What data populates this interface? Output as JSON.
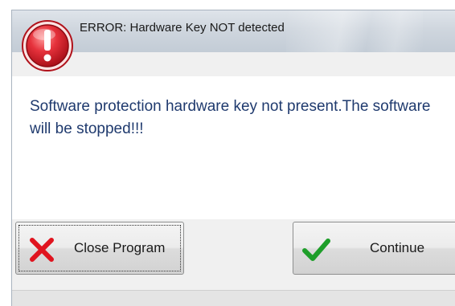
{
  "dialog": {
    "title": "ERROR: Hardware Key NOT detected",
    "message": "Software protection hardware key not present.The software will be stopped!!!",
    "icon": "error-icon"
  },
  "buttons": {
    "close": {
      "label": "Close Program",
      "icon": "close-x-icon"
    },
    "continue": {
      "label": "Continue",
      "icon": "checkmark-icon"
    }
  },
  "colors": {
    "message_text": "#1f3a6e",
    "error_red": "#d61f2c",
    "check_green": "#1e9e2a"
  }
}
